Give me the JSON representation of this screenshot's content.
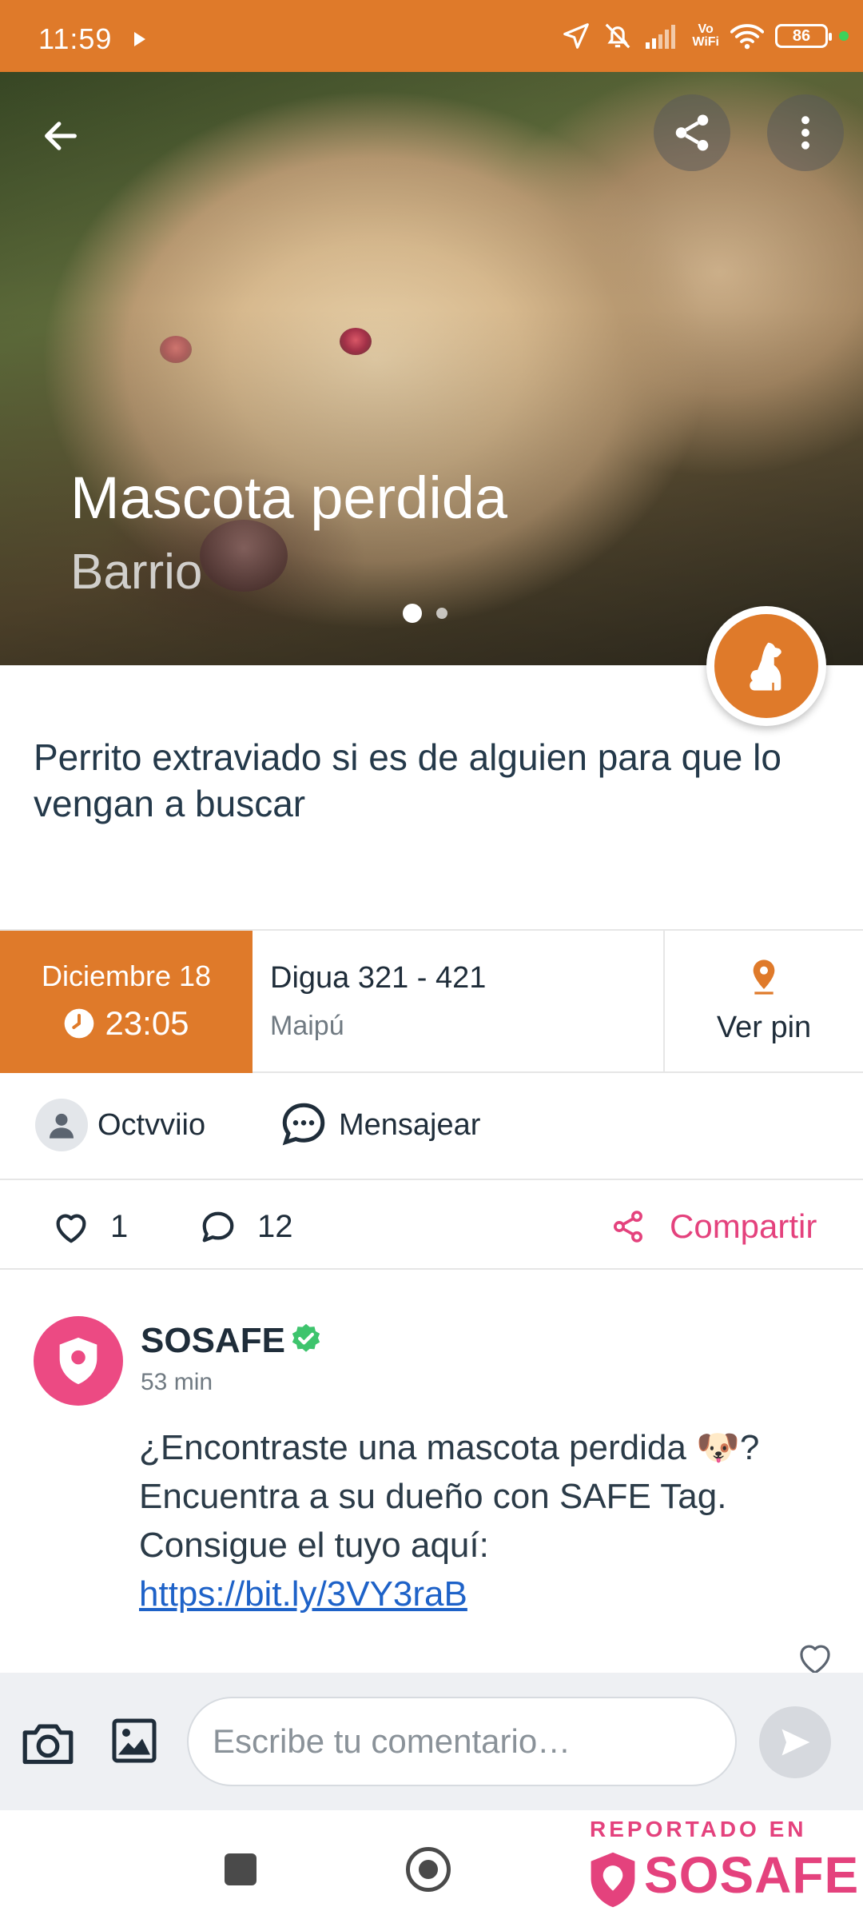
{
  "status_bar": {
    "time": "11:59",
    "battery": "86",
    "vowifi_top": "Vo",
    "vowifi_bottom": "WiFi"
  },
  "hero": {
    "title": "Mascota perdida",
    "subtitle": "Barrio",
    "slide_count": 2,
    "active_slide": 1
  },
  "description": "Perrito extraviado si es de alguien para que lo vengan a buscar",
  "info": {
    "date": "Diciembre 18",
    "time": "23:05",
    "address": "Digua  321 - 421",
    "city": "Maipú",
    "pin_label": "Ver pin"
  },
  "user": {
    "name": "Octvviio",
    "message_label": "Mensajear"
  },
  "actions": {
    "likes": "1",
    "comments": "12",
    "share_label": "Compartir"
  },
  "comment": {
    "author": "SOSAFE",
    "time": "53 min",
    "text": "¿Encontraste una mascota perdida 🐶? Encuentra a su dueño con SAFE Tag. Consigue el tuyo aquí: ",
    "link": "https://bit.ly/3VY3raB"
  },
  "composer": {
    "placeholder": "Escribe tu comentario…"
  },
  "watermark": {
    "top": "REPORTADO EN",
    "brand": "SOSAFE"
  },
  "colors": {
    "brand_orange": "#df7a2a",
    "brand_pink": "#e4427d",
    "verified_green": "#3ec46d",
    "link_blue": "#1e62c8"
  },
  "icons": [
    "back-arrow-icon",
    "share-icon",
    "more-vert-icon",
    "dog-icon",
    "clock-icon",
    "location-pin-icon",
    "user-icon",
    "chat-bubble-icon",
    "heart-icon",
    "comment-icon",
    "share-nodes-icon",
    "verified-icon",
    "camera-icon",
    "image-icon",
    "send-icon"
  ]
}
